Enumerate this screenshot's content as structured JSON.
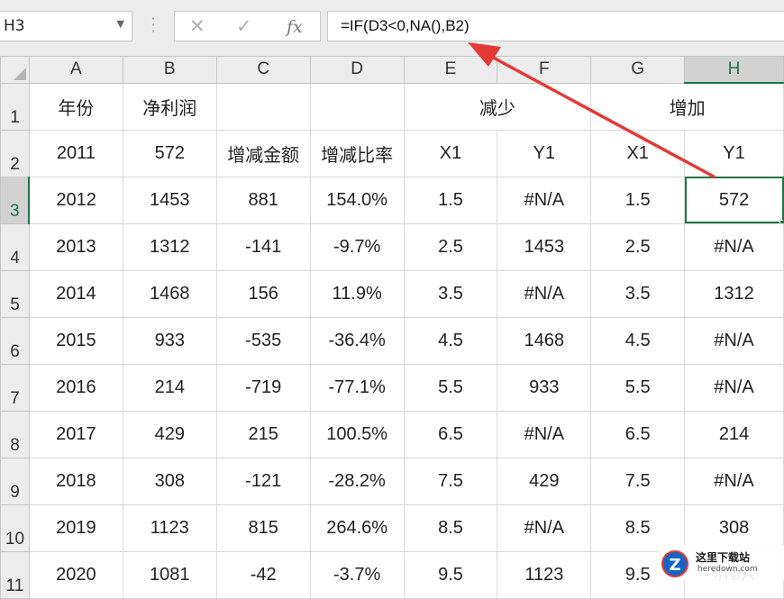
{
  "formula_bar": {
    "name_box": "H3",
    "cancel_icon": "cancel-x-icon",
    "enter_icon": "checkmark-icon",
    "fx_label": "fx",
    "formula": "=IF(D3<0,NA(),B2)"
  },
  "columns": [
    "A",
    "B",
    "C",
    "D",
    "E",
    "F",
    "G",
    "H"
  ],
  "active_column": "H",
  "active_row": "3",
  "selected_cell": "H3",
  "header_row1": {
    "row": "1",
    "a": "年份",
    "b": "净利润",
    "ef": "减少",
    "gh": "增加"
  },
  "header_row2": {
    "row": "2",
    "a": "2011",
    "b": "572",
    "c": "增减金额",
    "d": "增减比率",
    "e": "X1",
    "f": "Y1",
    "g": "X1",
    "h": "Y1"
  },
  "rows": [
    {
      "row": "3",
      "cells": [
        "2012",
        "1453",
        "881",
        "154.0%",
        "1.5",
        "#N/A",
        "1.5",
        "572"
      ]
    },
    {
      "row": "4",
      "cells": [
        "2013",
        "1312",
        "-141",
        "-9.7%",
        "2.5",
        "1453",
        "2.5",
        "#N/A"
      ]
    },
    {
      "row": "5",
      "cells": [
        "2014",
        "1468",
        "156",
        "11.9%",
        "3.5",
        "#N/A",
        "3.5",
        "1312"
      ]
    },
    {
      "row": "6",
      "cells": [
        "2015",
        "933",
        "-535",
        "-36.4%",
        "4.5",
        "1468",
        "4.5",
        "#N/A"
      ]
    },
    {
      "row": "7",
      "cells": [
        "2016",
        "214",
        "-719",
        "-77.1%",
        "5.5",
        "933",
        "5.5",
        "#N/A"
      ]
    },
    {
      "row": "8",
      "cells": [
        "2017",
        "429",
        "215",
        "100.5%",
        "6.5",
        "#N/A",
        "6.5",
        "214"
      ]
    },
    {
      "row": "9",
      "cells": [
        "2018",
        "308",
        "-121",
        "-28.2%",
        "7.5",
        "429",
        "7.5",
        "#N/A"
      ]
    },
    {
      "row": "10",
      "cells": [
        "2019",
        "1123",
        "815",
        "264.6%",
        "8.5",
        "#N/A",
        "8.5",
        "308"
      ]
    },
    {
      "row": "11",
      "cells": [
        "2020",
        "1081",
        "-42",
        "-3.7%",
        "9.5",
        "1123",
        "9.5",
        "#N/A"
      ]
    }
  ],
  "annotation": {
    "color": "#e53935"
  },
  "watermark": {
    "title": "这里下载站",
    "url": "heredown.com",
    "logo_letter": "Z"
  },
  "colors": {
    "excel_green": "#217346",
    "grid_line": "#d9d9d9",
    "header_bg": "#ececec"
  }
}
